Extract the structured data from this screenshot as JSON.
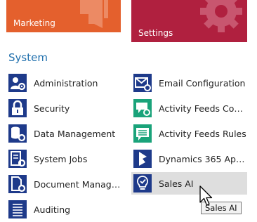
{
  "tiles": {
    "marketing": {
      "label": "Marketing",
      "color": "#e4602d"
    },
    "settings": {
      "label": "Settings",
      "color": "#b0203f"
    }
  },
  "section": {
    "title": "System"
  },
  "left_column": [
    {
      "label": "Administration",
      "icon": "administration-icon"
    },
    {
      "label": "Security",
      "icon": "lock-icon"
    },
    {
      "label": "Data Management",
      "icon": "database-icon"
    },
    {
      "label": "System Jobs",
      "icon": "system-jobs-icon"
    },
    {
      "label": "Document Manage...",
      "icon": "document-management-icon"
    },
    {
      "label": "Auditing",
      "icon": "auditing-icon"
    }
  ],
  "right_column": [
    {
      "label": "Email Configuration",
      "icon": "email-icon"
    },
    {
      "label": "Activity Feeds Confi...",
      "icon": "activity-feeds-config-icon"
    },
    {
      "label": "Activity Feeds Rules",
      "icon": "activity-feeds-rules-icon"
    },
    {
      "label": "Dynamics 365 App ...",
      "icon": "dynamics-365-icon"
    },
    {
      "label": "Sales AI",
      "icon": "sales-ai-icon",
      "hovered": true
    }
  ],
  "tooltip": {
    "text": "Sales AI"
  },
  "colors": {
    "accent": "#1f6fad",
    "icon_blue": "#1e3a8a",
    "icon_teal": "#1aa37a",
    "hover_bg": "#dedede"
  }
}
